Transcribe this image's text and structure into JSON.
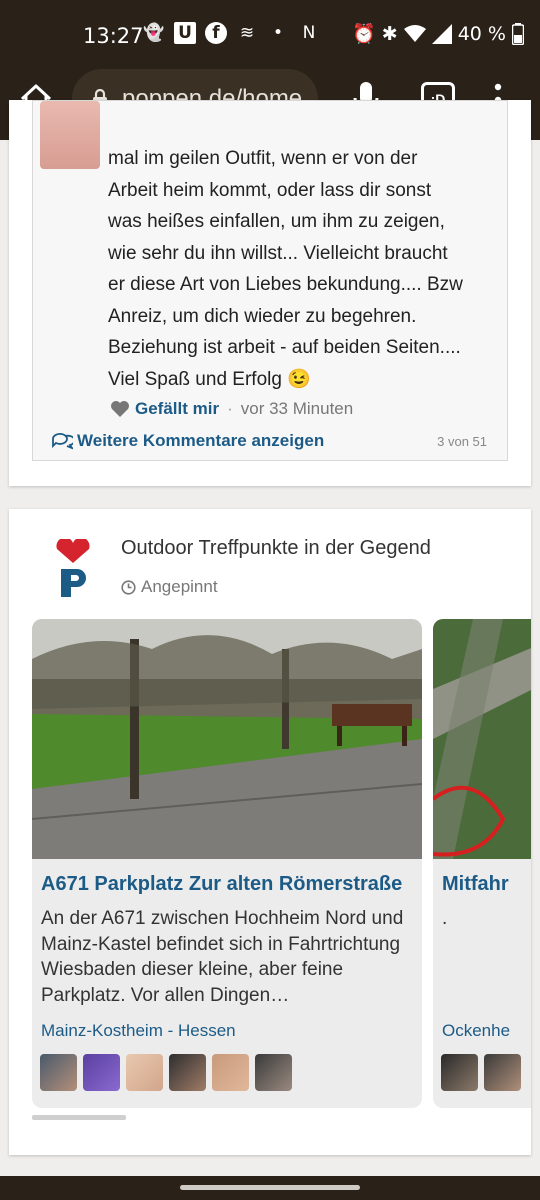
{
  "status_bar": {
    "time": "13:27",
    "battery": "40 %",
    "icons": [
      "snapchat-icon",
      "u-icon",
      "facebook-icon",
      "boat-icon",
      "dot-icon",
      "nfc-icon",
      "alarm-icon",
      "bluetooth-icon",
      "wifi-icon",
      "signal-icon",
      "battery-icon"
    ]
  },
  "browser": {
    "url": "poppen.de/home",
    "tab_label": ":D"
  },
  "comment": {
    "lines": [
      "mal im geilen Outfit, wenn er von der",
      "Arbeit heim kommt, oder lass dir sonst",
      "was heißes einfallen, um ihm zu zeigen,",
      "wie sehr du ihn willst... Vielleicht braucht",
      "er diese Art von Liebes bekundung.... Bzw",
      "Anreiz, um dich wieder zu begehren.",
      "Beziehung ist arbeit - auf beiden Seiten....",
      "Viel Spaß und Erfolg 😉"
    ],
    "like_label": "Gefällt mir",
    "separator": "·",
    "time": "vor 33 Minuten",
    "more_label": "Weitere Kommentare anzeigen",
    "count": "3 von 51"
  },
  "post": {
    "title": "Outdoor Treffpunkte in der Gegend",
    "pinned": "Angepinnt",
    "places": [
      {
        "name": "A671 Parkplatz Zur alten Römerstraße",
        "description": "An der A671 zwischen Hochheim Nord und Mainz-Kastel befindet sich in Fahrtrichtung Wiesbaden dieser kleine, aber feine Parkplatz. Vor allen Dingen…",
        "city": "Mainz-Kostheim",
        "loc_sep": " - ",
        "region": "Hessen"
      },
      {
        "name": "Mitfahr",
        "description": ".",
        "city": "Ockenhe"
      }
    ]
  },
  "colors": {
    "link": "#1d5b87",
    "brand_red": "#d6242f",
    "brand_blue": "#1d5b87",
    "bar": "#2a2219"
  }
}
